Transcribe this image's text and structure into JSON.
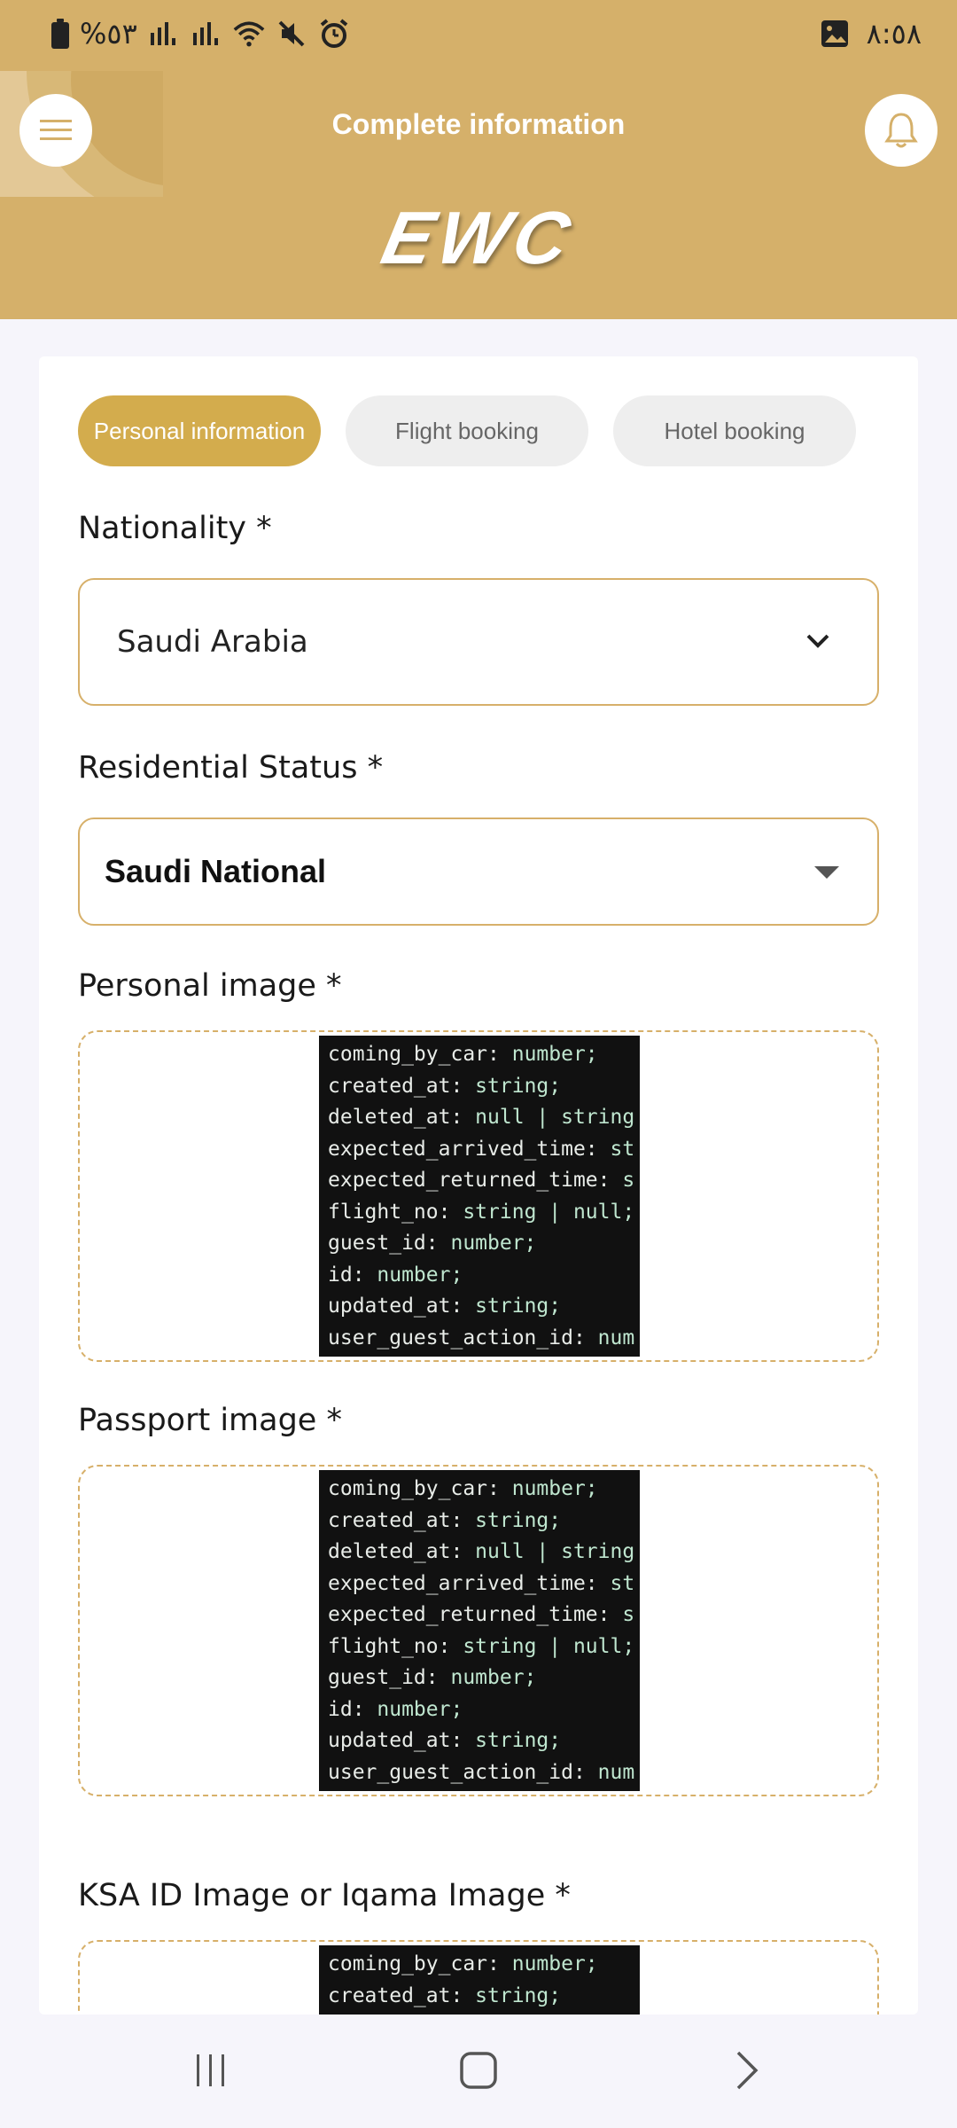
{
  "status_bar": {
    "battery_text": "%٥٣",
    "time": "٨:٥٨"
  },
  "header": {
    "title": "Complete information",
    "logo_text": "EWC"
  },
  "tabs": [
    {
      "label": "Personal information",
      "active": true
    },
    {
      "label": "Flight booking",
      "active": false
    },
    {
      "label": "Hotel booking",
      "active": false
    }
  ],
  "form": {
    "nationality": {
      "label": "Nationality *",
      "value": "Saudi Arabia"
    },
    "residential_status": {
      "label": "Residential Status *",
      "value": "Saudi National"
    },
    "personal_image": {
      "label": "Personal image *"
    },
    "passport_image": {
      "label": "Passport image *"
    },
    "ksa_id_image": {
      "label": "KSA ID Image or Iqama Image *"
    }
  },
  "code_preview": [
    {
      "key": "coming_by_car:",
      "type": " number;"
    },
    {
      "key": "created_at:",
      "type": " string;"
    },
    {
      "key": "deleted_at:",
      "type": " null | string"
    },
    {
      "key": "expected_arrived_time:",
      "type": " st"
    },
    {
      "key": "expected_returned_time:",
      "type": " s"
    },
    {
      "key": "flight_no:",
      "type": " string | null;"
    },
    {
      "key": "guest_id:",
      "type": " number;"
    },
    {
      "key": "id:",
      "type": " number;"
    },
    {
      "key": "updated_at:",
      "type": " string;"
    },
    {
      "key": "user_guest_action_id:",
      "type": " num"
    }
  ],
  "colors": {
    "header_bg": "#d5b06a",
    "accent": "#d3ac4d",
    "border": "#d7b06a",
    "page_bg": "#f6f5fb"
  }
}
